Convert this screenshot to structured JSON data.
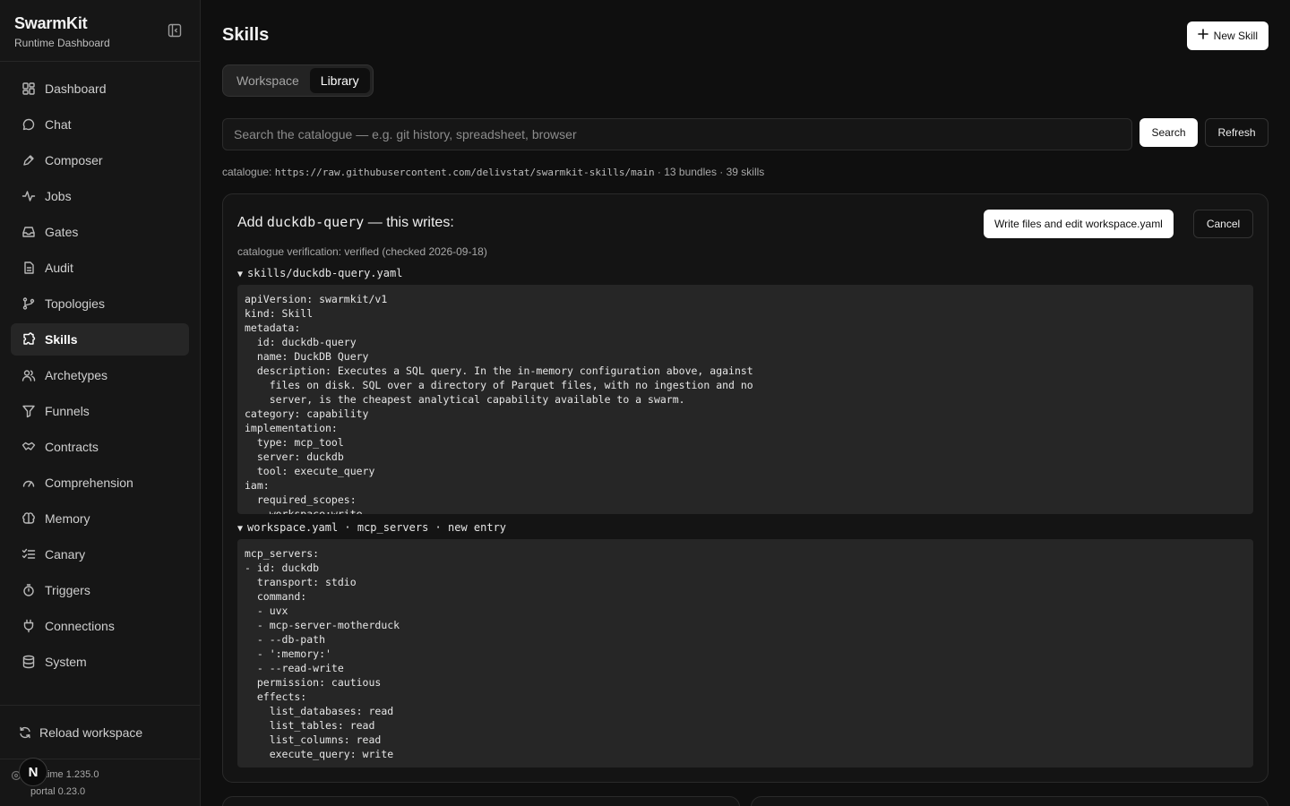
{
  "brand": {
    "title": "SwarmKit",
    "subtitle": "Runtime Dashboard"
  },
  "sidebar": {
    "items": [
      {
        "label": "Dashboard",
        "icon": "dashboard-icon"
      },
      {
        "label": "Chat",
        "icon": "chat-icon"
      },
      {
        "label": "Composer",
        "icon": "composer-icon"
      },
      {
        "label": "Jobs",
        "icon": "activity-icon"
      },
      {
        "label": "Gates",
        "icon": "inbox-icon"
      },
      {
        "label": "Audit",
        "icon": "audit-icon"
      },
      {
        "label": "Topologies",
        "icon": "branch-icon"
      },
      {
        "label": "Skills",
        "icon": "puzzle-icon",
        "active": true
      },
      {
        "label": "Archetypes",
        "icon": "users-icon"
      },
      {
        "label": "Funnels",
        "icon": "filter-icon"
      },
      {
        "label": "Contracts",
        "icon": "handshake-icon"
      },
      {
        "label": "Comprehension",
        "icon": "gauge-icon"
      },
      {
        "label": "Memory",
        "icon": "brain-icon"
      },
      {
        "label": "Canary",
        "icon": "checklist-icon"
      },
      {
        "label": "Triggers",
        "icon": "timer-icon"
      },
      {
        "label": "Connections",
        "icon": "plug-icon"
      },
      {
        "label": "System",
        "icon": "database-icon"
      }
    ],
    "reload_label": "Reload workspace",
    "runtime_version": "runtime 1.235.0",
    "portal_version": "portal 0.23.0",
    "avatar_initial": "N"
  },
  "header": {
    "title": "Skills",
    "new_skill_label": "New Skill"
  },
  "tabs": [
    {
      "label": "Workspace"
    },
    {
      "label": "Library",
      "active": true
    }
  ],
  "search": {
    "placeholder": "Search the catalogue — e.g. git history, spreadsheet, browser",
    "search_label": "Search",
    "refresh_label": "Refresh"
  },
  "catalogue": {
    "prefix": "catalogue: ",
    "url": "https://raw.githubusercontent.com/delivstat/swarmkit-skills/main",
    "stats": " · 13 bundles · 39 skills"
  },
  "dialog": {
    "title_prefix": "Add ",
    "skill_id": "duckdb-query",
    "title_suffix": " — this writes:",
    "write_label": "Write files and edit workspace.yaml",
    "cancel_label": "Cancel",
    "verification": "catalogue verification: verified (checked 2026-09-18)",
    "file1_summary": "skills/duckdb-query.yaml",
    "file1_code": "apiVersion: swarmkit/v1\nkind: Skill\nmetadata:\n  id: duckdb-query\n  name: DuckDB Query\n  description: Executes a SQL query. In the in-memory configuration above, against\n    files on disk. SQL over a directory of Parquet files, with no ingestion and no\n    server, is the cheapest analytical capability available to a swarm.\ncategory: capability\nimplementation:\n  type: mcp_tool\n  server: duckdb\n  tool: execute_query\niam:\n  required_scopes:\n    workspace:write",
    "file2_summary": "workspace.yaml · mcp_servers · new entry",
    "file2_code": "mcp_servers:\n- id: duckdb\n  transport: stdio\n  command:\n  - uvx\n  - mcp-server-motherduck\n  - --db-path\n  - ':memory:'\n  - --read-write\n  permission: cautious\n  effects:\n    list_databases: read\n    list_tables: read\n    list_columns: read\n    execute_query: write"
  }
}
